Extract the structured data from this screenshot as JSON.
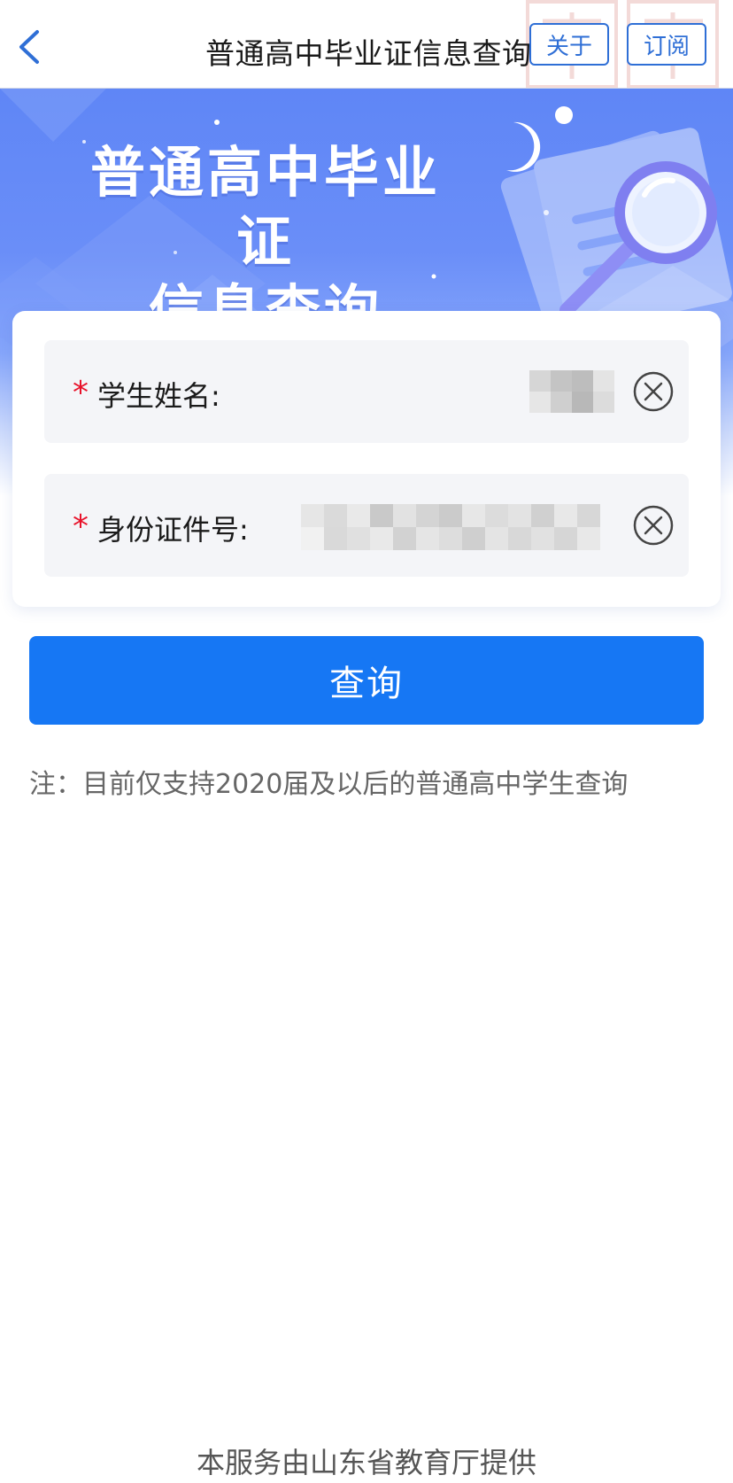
{
  "header": {
    "title": "普通高中毕业证信息查询",
    "about_label": "关于",
    "subscribe_label": "订阅"
  },
  "banner": {
    "title_line1": "普通高中毕业证",
    "title_line2": "信息查询"
  },
  "form": {
    "required_mark": "*",
    "name_label": "学生姓名:",
    "name_value": "",
    "id_label": "身份证件号:",
    "id_value": ""
  },
  "query_button_label": "查询",
  "note": "注：目前仅支持2020届及以后的普通高中学生查询",
  "footer": "本服务由山东省教育厅提供",
  "colors": {
    "primary": "#1677f4",
    "accent_border": "#2f6fd6",
    "required": "#e8132b",
    "banner": "#6a8ef8",
    "field_bg": "#f4f5f8"
  },
  "icons": {
    "back": "chevron-left-icon",
    "clear": "close-circle-icon",
    "banner_illustration": "magnifier-icon"
  }
}
